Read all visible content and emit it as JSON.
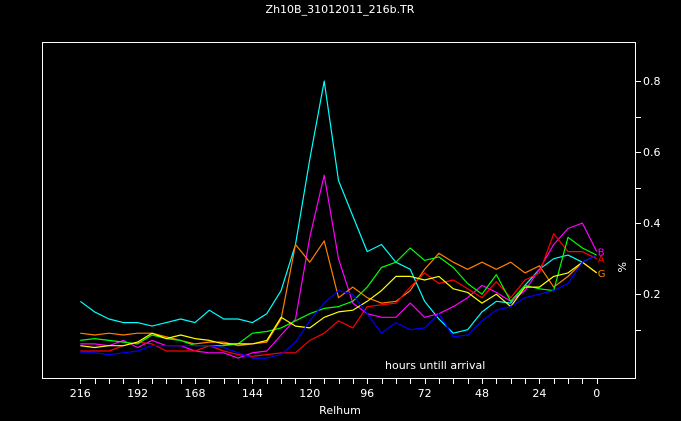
{
  "chart_data": {
    "type": "line",
    "title": "Zh10B_31012011_216b.TR",
    "xlabel": "Relhum",
    "ylabel": "%",
    "annotation": "hours untill arrival",
    "xlim": [
      232,
      -16
    ],
    "ylim": [
      -0.036,
      0.91
    ],
    "x_ticks": [
      216,
      192,
      168,
      144,
      120,
      96,
      72,
      48,
      24,
      0
    ],
    "x_tick_labels": [
      "216",
      "192",
      "168",
      "144",
      "120",
      "96",
      "72",
      "48",
      "24",
      "0"
    ],
    "x_minor_step": 6,
    "y_ticks": [
      0.2,
      0.4,
      0.6,
      0.8
    ],
    "y_tick_labels": [
      "0.2",
      "0.4",
      "0.6",
      "0.8"
    ],
    "y_minor_step": 0.1,
    "grid": false,
    "x": [
      216,
      210,
      204,
      198,
      192,
      186,
      180,
      174,
      168,
      162,
      156,
      150,
      144,
      138,
      132,
      126,
      120,
      114,
      108,
      102,
      96,
      90,
      84,
      78,
      72,
      66,
      60,
      54,
      48,
      42,
      36,
      30,
      24,
      18,
      12,
      6,
      0
    ],
    "series": [
      {
        "name": "cyan",
        "color": "#00ffff",
        "values": [
          0.18,
          0.15,
          0.13,
          0.12,
          0.12,
          0.11,
          0.12,
          0.13,
          0.12,
          0.155,
          0.13,
          0.13,
          0.12,
          0.145,
          0.21,
          0.34,
          0.58,
          0.8,
          0.52,
          0.42,
          0.32,
          0.34,
          0.29,
          0.27,
          0.18,
          0.13,
          0.09,
          0.1,
          0.15,
          0.18,
          0.175,
          0.225,
          0.27,
          0.3,
          0.31,
          0.29,
          0.31
        ]
      },
      {
        "name": "magenta",
        "color": "#ff00ff",
        "end_label": "B",
        "values": [
          0.06,
          0.06,
          0.055,
          0.07,
          0.05,
          0.07,
          0.055,
          0.055,
          0.04,
          0.035,
          0.035,
          0.02,
          0.035,
          0.04,
          0.085,
          0.13,
          0.36,
          0.535,
          0.3,
          0.175,
          0.145,
          0.135,
          0.135,
          0.175,
          0.135,
          0.145,
          0.165,
          0.19,
          0.225,
          0.205,
          0.18,
          0.21,
          0.27,
          0.34,
          0.385,
          0.4,
          0.32
        ]
      },
      {
        "name": "orange",
        "color": "#ff8000",
        "end_label": "G",
        "values": [
          0.09,
          0.085,
          0.09,
          0.085,
          0.09,
          0.09,
          0.08,
          0.07,
          0.06,
          0.065,
          0.065,
          0.055,
          0.06,
          0.065,
          0.13,
          0.34,
          0.29,
          0.35,
          0.19,
          0.22,
          0.19,
          0.175,
          0.18,
          0.21,
          0.27,
          0.315,
          0.29,
          0.27,
          0.29,
          0.27,
          0.29,
          0.26,
          0.28,
          0.22,
          0.25,
          0.29,
          0.26
        ]
      },
      {
        "name": "red",
        "color": "#ff0000",
        "end_label": "A",
        "values": [
          0.04,
          0.04,
          0.04,
          0.055,
          0.065,
          0.06,
          0.04,
          0.04,
          0.04,
          0.055,
          0.04,
          0.03,
          0.025,
          0.03,
          0.035,
          0.035,
          0.07,
          0.09,
          0.125,
          0.105,
          0.165,
          0.17,
          0.175,
          0.22,
          0.26,
          0.23,
          0.24,
          0.215,
          0.19,
          0.235,
          0.19,
          0.24,
          0.26,
          0.37,
          0.32,
          0.32,
          0.3
        ]
      },
      {
        "name": "green",
        "color": "#00ff00",
        "values": [
          0.07,
          0.075,
          0.07,
          0.065,
          0.06,
          0.085,
          0.075,
          0.07,
          0.055,
          0.055,
          0.055,
          0.06,
          0.09,
          0.095,
          0.105,
          0.125,
          0.145,
          0.16,
          0.165,
          0.18,
          0.22,
          0.275,
          0.29,
          0.33,
          0.295,
          0.305,
          0.275,
          0.23,
          0.2,
          0.255,
          0.18,
          0.225,
          0.215,
          0.21,
          0.36,
          0.33,
          0.31
        ]
      },
      {
        "name": "yellow",
        "color": "#ffff00",
        "values": [
          0.055,
          0.05,
          0.055,
          0.055,
          0.065,
          0.09,
          0.075,
          0.085,
          0.075,
          0.07,
          0.06,
          0.06,
          0.06,
          0.07,
          0.135,
          0.11,
          0.105,
          0.135,
          0.15,
          0.155,
          0.18,
          0.21,
          0.25,
          0.25,
          0.24,
          0.25,
          0.215,
          0.205,
          0.175,
          0.2,
          0.165,
          0.22,
          0.22,
          0.25,
          0.26,
          0.29,
          0.26
        ]
      },
      {
        "name": "blue",
        "color": "#0000ff",
        "values": [
          0.035,
          0.035,
          0.03,
          0.035,
          0.04,
          0.055,
          0.055,
          0.055,
          0.055,
          0.055,
          0.05,
          0.035,
          0.02,
          0.02,
          0.03,
          0.065,
          0.125,
          0.175,
          0.21,
          0.2,
          0.145,
          0.09,
          0.12,
          0.1,
          0.105,
          0.145,
          0.08,
          0.085,
          0.125,
          0.155,
          0.165,
          0.19,
          0.2,
          0.21,
          0.23,
          0.29,
          0.31
        ]
      }
    ]
  }
}
